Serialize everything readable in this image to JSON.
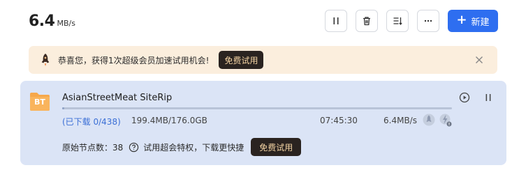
{
  "header": {
    "speed_value": "6.4",
    "speed_unit": "MB/s",
    "new_button_label": "新建"
  },
  "promo": {
    "text": "恭喜您，获得1次超级会员加速试用机会!",
    "button_label": "免费试用"
  },
  "task": {
    "icon_text": "BT",
    "name": "AsianStreetMeat SiteRip",
    "downloaded_text": "(已下载 0/438)",
    "size_text": "199.4MB/176.0GB",
    "eta": "07:45:30",
    "rate": "6.4MB/s",
    "progress_fraction": 0.0011,
    "nodes_text": "原始节点数：38",
    "hint_text": "试用超会特权，下载更快捷",
    "trial_button_label": "免费试用"
  },
  "colors": {
    "accent": "#2e6ef0",
    "promo_bg": "#fbeedd",
    "task_bg": "#dbe4f6",
    "dark_button": "#2a2320"
  },
  "icons": [
    "pause-icon",
    "trash-icon",
    "sort-icon",
    "more-icon",
    "plus-icon",
    "rocket-icon",
    "close-icon",
    "bt-folder-icon",
    "play-icon",
    "accelerate-icon",
    "flash-icon",
    "help-icon"
  ]
}
